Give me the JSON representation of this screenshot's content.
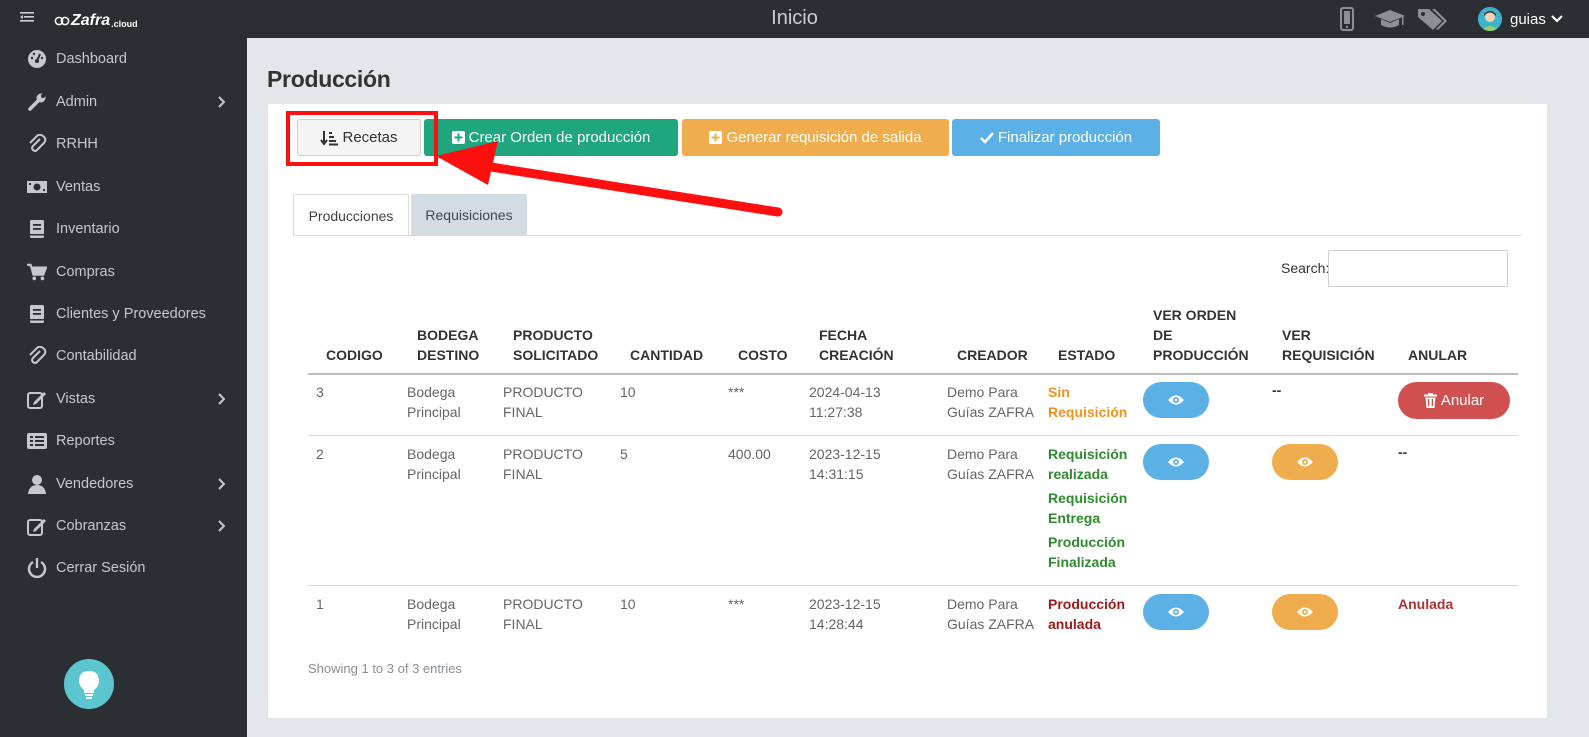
{
  "app": {
    "logo_text": "Zafra",
    "logo_suffix": ".cloud",
    "title": "Inicio",
    "user_name": "guias"
  },
  "sidebar": {
    "items": [
      {
        "label": "Dashboard",
        "icon": "dashboard-icon",
        "has_submenu": false
      },
      {
        "label": "Admin",
        "icon": "wrench-icon",
        "has_submenu": true
      },
      {
        "label": "RRHH",
        "icon": "paperclip-icon",
        "has_submenu": false
      },
      {
        "label": "Ventas",
        "icon": "money-icon",
        "has_submenu": false
      },
      {
        "label": "Inventario",
        "icon": "book-icon",
        "has_submenu": false
      },
      {
        "label": "Compras",
        "icon": "cart-icon",
        "has_submenu": false
      },
      {
        "label": "Clientes y Proveedores",
        "icon": "book-icon",
        "has_submenu": false
      },
      {
        "label": "Contabilidad",
        "icon": "paperclip-icon",
        "has_submenu": false
      },
      {
        "label": "Vistas",
        "icon": "edit-icon",
        "has_submenu": true
      },
      {
        "label": "Reportes",
        "icon": "list-icon",
        "has_submenu": false
      },
      {
        "label": "Vendedores",
        "icon": "user-icon",
        "has_submenu": true
      },
      {
        "label": "Cobranzas",
        "icon": "edit-icon",
        "has_submenu": true
      },
      {
        "label": "Cerrar Sesión",
        "icon": "power-icon",
        "has_submenu": false
      }
    ]
  },
  "main": {
    "page_title": "Producción",
    "buttons": {
      "recetas": "Recetas",
      "crear": "Crear Orden de producción",
      "generar": "Generar requisición de salida",
      "finalizar": "Finalizar producción"
    },
    "tabs": [
      {
        "label": "Producciones",
        "active": true
      },
      {
        "label": "Requisiciones",
        "active": false
      }
    ],
    "search_label": "Search:",
    "search_value": "",
    "table": {
      "headers": {
        "codigo": "CODIGO",
        "bodega1": "BODEGA",
        "bodega2": "DESTINO",
        "producto1": "PRODUCTO",
        "producto2": "SOLICITADO",
        "cantidad": "CANTIDAD",
        "costo": "COSTO",
        "fecha1": "FECHA",
        "fecha2": "CREACIÓN",
        "creador": "CREADOR",
        "estado": "ESTADO",
        "ver_orden1": "VER ORDEN",
        "ver_orden2": "DE",
        "ver_orden3": "PRODUCCIÓN",
        "ver_req1": "VER",
        "ver_req2": "REQUISICIÓN",
        "anular": "ANULAR"
      },
      "rows": [
        {
          "codigo": "3",
          "bodega1": "Bodega",
          "bodega2": "Principal",
          "producto1": "PRODUCTO",
          "producto2": "FINAL",
          "cantidad": "10",
          "costo": "***",
          "fecha1": "2024-04-13",
          "fecha2": "11:27:38",
          "creador1": "Demo Para",
          "creador2": "Guías ZAFRA",
          "estado": [
            "Sin",
            "Requisición"
          ],
          "ver_requisicion": "--",
          "anular_label": "Anular"
        },
        {
          "codigo": "2",
          "bodega1": "Bodega",
          "bodega2": "Principal",
          "producto1": "PRODUCTO",
          "producto2": "FINAL",
          "cantidad": "5",
          "costo": "400.00",
          "fecha1": "2023-12-15",
          "fecha2": "14:31:15",
          "creador1": "Demo Para",
          "creador2": "Guías ZAFRA",
          "estado": [
            "Requisición",
            "realizada",
            "Requisición",
            "Entrega",
            "Producción",
            "Finalizada"
          ],
          "anular_text": "--"
        },
        {
          "codigo": "1",
          "bodega1": "Bodega",
          "bodega2": "Principal",
          "producto1": "PRODUCTO",
          "producto2": "FINAL",
          "cantidad": "10",
          "costo": "***",
          "fecha1": "2023-12-15",
          "fecha2": "14:28:44",
          "creador1": "Demo Para",
          "creador2": "Guías ZAFRA",
          "estado": [
            "Producción",
            "anulada"
          ],
          "anular_text": "Anulada"
        }
      ]
    },
    "footer_info": "Showing 1 to 3 of 3 entries"
  },
  "colors": {
    "sidebar_bg": "#2b2e33",
    "green": "#1fa67f",
    "orange": "#f0ad4e",
    "blue": "#5bb0e5",
    "red": "#d05050",
    "status_orange": "#f0901e",
    "status_green": "#2e8b2e",
    "status_darkred": "#a01818",
    "annotation_red": "#ff1010"
  }
}
